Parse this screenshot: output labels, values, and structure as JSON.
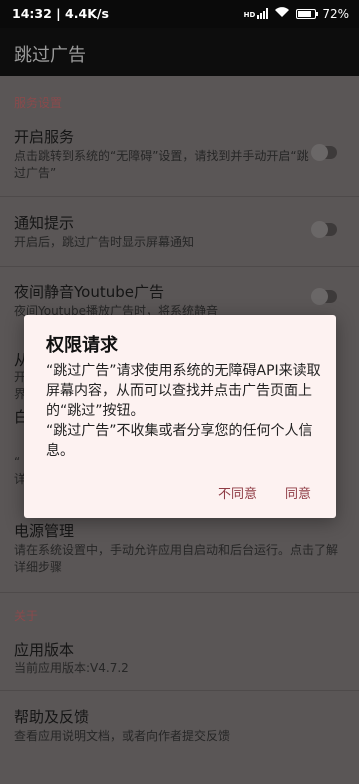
{
  "statusbar": {
    "time": "14:32 | 4.4K/s",
    "battery": "72",
    "battery_suffix": "%",
    "signal_label": "HD"
  },
  "appbar": {
    "title": "跳过广告"
  },
  "sections": {
    "service": {
      "header": "服务设置"
    },
    "about": {
      "header": "关于"
    }
  },
  "prefs": {
    "enable": {
      "title": "开启服务",
      "summary": "点击跳转到系统的“无障碍”设置，请找到并手动开启“跳过广告”"
    },
    "notify": {
      "title": "通知提示",
      "summary": "开启后，跳过广告时显示屏幕通知"
    },
    "youtube": {
      "title": "夜间静音Youtube广告",
      "summary": "夜间Youtube播放广告时，将系统静音"
    },
    "hidden1": {
      "title": "从",
      "summary": "开",
      "summary2": "界"
    },
    "hidden2": {
      "title": "白",
      "summary": "“",
      "summary2": "详"
    },
    "power": {
      "title": "电源管理",
      "summary": "请在系统设置中，手动允许应用自启动和后台运行。点击了解详细步骤"
    },
    "version": {
      "title": "应用版本",
      "summary": "当前应用版本:V4.7.2"
    },
    "help": {
      "title": "帮助及反馈",
      "summary": "查看应用说明文档，或者向作者提交反馈"
    }
  },
  "dialog": {
    "title": "权限请求",
    "message_1": "“跳过广告”请求使用系统的无障碍API来读取屏幕内容，从而可以查找并点击广告页面上的“跳过”按钮。",
    "message_2": "“跳过广告”不收集或者分享您的任何个人信息。",
    "decline": "不同意",
    "accept": "同意"
  }
}
